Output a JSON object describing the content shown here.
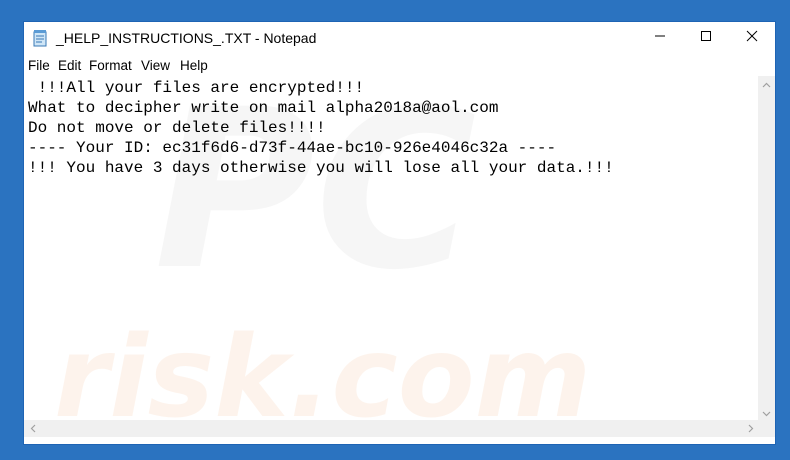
{
  "window": {
    "title": "_HELP_INSTRUCTIONS_.TXT - Notepad",
    "icon": "notepad-icon",
    "controls": {
      "minimize": "minimize-icon",
      "maximize": "maximize-icon",
      "close": "close-icon"
    }
  },
  "menu": {
    "items": [
      {
        "label": "File"
      },
      {
        "label": "Edit"
      },
      {
        "label": "Format"
      },
      {
        "label": "View"
      },
      {
        "label": "Help"
      }
    ]
  },
  "document": {
    "text": " !!!All your files are encrypted!!!\nWhat to decipher write on mail alpha2018a@aol.com\nDo not move or delete files!!!!\n---- Your ID: ec31f6d6-d73f-44ae-bc10-926e4046c32a ----\n!!! You have 3 days otherwise you will lose all your data.!!!"
  },
  "watermark": {
    "logo_text": "PC",
    "site_text": "risk.com"
  },
  "colors": {
    "desktop": "#2b73c0",
    "window_border": "#1e64b4",
    "scrollbar": "#f0f0f0"
  }
}
